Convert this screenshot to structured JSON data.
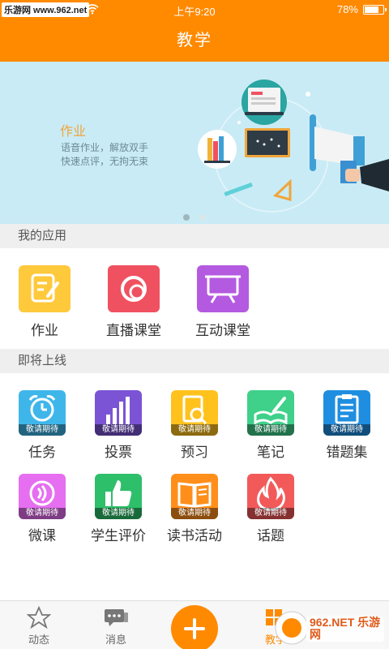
{
  "status": {
    "watermark": "乐游网 www.962.net",
    "time": "上午9:20",
    "battery": "78%",
    "battery_level": 0.78
  },
  "nav": {
    "title": "教学"
  },
  "banner": {
    "title": "作业",
    "line1": "语音作业，解放双手",
    "line2": "快速点评，无拘无束",
    "page_index": 0,
    "page_count": 2
  },
  "sections": {
    "my_apps": "我的应用",
    "coming_soon": "即将上线"
  },
  "my_apps": [
    {
      "label": "作业",
      "color": "#ffc93c",
      "icon": "homework-icon"
    },
    {
      "label": "直播课堂",
      "color": "#ef5160",
      "icon": "live-class-icon"
    },
    {
      "label": "互动课堂",
      "color": "#b45ae0",
      "icon": "interactive-class-icon"
    }
  ],
  "coming_badge": "敬请期待",
  "coming_apps": [
    {
      "label": "任务",
      "color": "#3fb6ea",
      "icon": "alarm-clock-icon"
    },
    {
      "label": "投票",
      "color": "#7b54d6",
      "icon": "bar-chart-icon"
    },
    {
      "label": "预习",
      "color": "#ffc21d",
      "icon": "document-search-icon"
    },
    {
      "label": "笔记",
      "color": "#3fd08a",
      "icon": "notebook-pencil-icon"
    },
    {
      "label": "错题集",
      "color": "#1f8ee0",
      "icon": "clipboard-icon"
    },
    {
      "label": "微课",
      "color": "#e66ef0",
      "icon": "wave-icon"
    },
    {
      "label": "学生评价",
      "color": "#2ebf6a",
      "icon": "thumbs-up-icon"
    },
    {
      "label": "读书活动",
      "color": "#ff8f1a",
      "icon": "book-icon"
    },
    {
      "label": "话题",
      "color": "#f25a5a",
      "icon": "flame-icon"
    }
  ],
  "tabbar": {
    "tab1": "动态",
    "tab2": "消息",
    "tab3": "教学",
    "active": "教学"
  },
  "watermark_962": "962.NET 乐游网"
}
